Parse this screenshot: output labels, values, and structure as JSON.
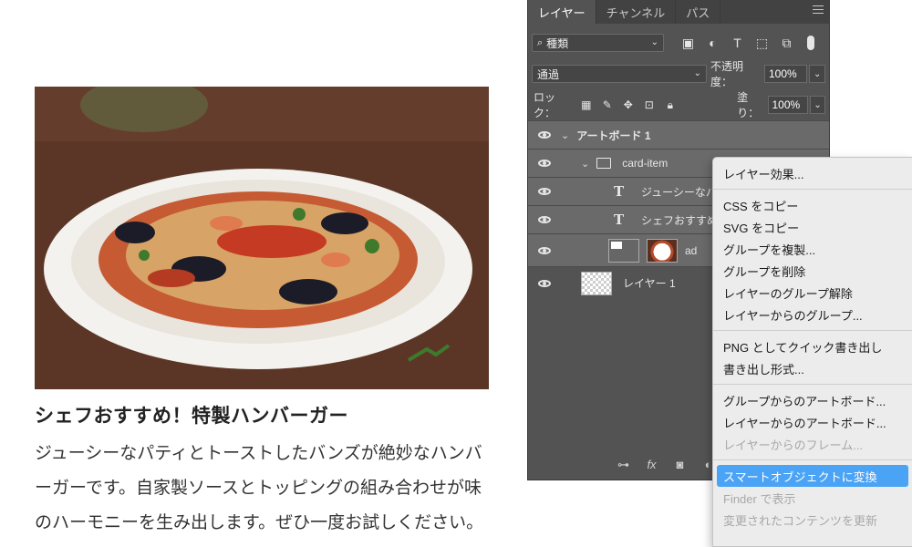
{
  "card": {
    "title": "シェフおすすめ！特製ハンバーガー",
    "description": "ジューシーなパティとトーストしたバンズが絶妙なハンバーガーです。自家製ソースとトッピングの組み合わせが味のハーモニーを生み出します。ぜひ一度お試しください。"
  },
  "panel": {
    "tabs": [
      {
        "label": "レイヤー",
        "active": true
      },
      {
        "label": "チャンネル",
        "active": false
      },
      {
        "label": "パス",
        "active": false
      }
    ],
    "filter": {
      "label": "種類"
    },
    "blend_mode": "通過",
    "opacity_label": "不透明度：",
    "opacity_value": "100%",
    "lock_label": "ロック：",
    "fill_label": "塗り：",
    "fill_value": "100%",
    "layers": [
      {
        "name": "アートボード 1",
        "type": "artboard"
      },
      {
        "name": "card-item",
        "type": "group"
      },
      {
        "name": "ジューシーなパ",
        "type": "text"
      },
      {
        "name": "シェフおすすめ",
        "type": "text"
      },
      {
        "name": "ad",
        "type": "smart-object"
      },
      {
        "name": "レイヤー 1",
        "type": "pixel"
      }
    ],
    "footer_icons": [
      "link-icon",
      "fx-icon",
      "mask-icon",
      "adjustment-icon"
    ]
  },
  "context_menu": {
    "items": [
      {
        "label": "レイヤー効果...",
        "disabled": false
      },
      {
        "sep": true
      },
      {
        "label": "CSS をコピー",
        "disabled": false
      },
      {
        "label": "SVG をコピー",
        "disabled": false
      },
      {
        "label": "グループを複製...",
        "disabled": false
      },
      {
        "label": "グループを削除",
        "disabled": false
      },
      {
        "label": "レイヤーのグループ解除",
        "disabled": false
      },
      {
        "label": "レイヤーからのグループ...",
        "disabled": false
      },
      {
        "sep": true
      },
      {
        "label": "PNG としてクイック書き出し",
        "disabled": false
      },
      {
        "label": "書き出し形式...",
        "disabled": false
      },
      {
        "sep": true
      },
      {
        "label": "グループからのアートボード...",
        "disabled": false
      },
      {
        "label": "レイヤーからのアートボード...",
        "disabled": false
      },
      {
        "label": "レイヤーからのフレーム...",
        "disabled": true
      },
      {
        "sep": true
      },
      {
        "label": "スマートオブジェクトに変換",
        "disabled": false,
        "highlighted": true
      },
      {
        "label": "Finder で表示",
        "disabled": true
      },
      {
        "label": "変更されたコンテンツを更新",
        "disabled": true
      }
    ]
  },
  "colors": {
    "panel_bg": "#535353",
    "menu_highlight": "#4aa3f5",
    "menu_bg": "#ececec"
  }
}
